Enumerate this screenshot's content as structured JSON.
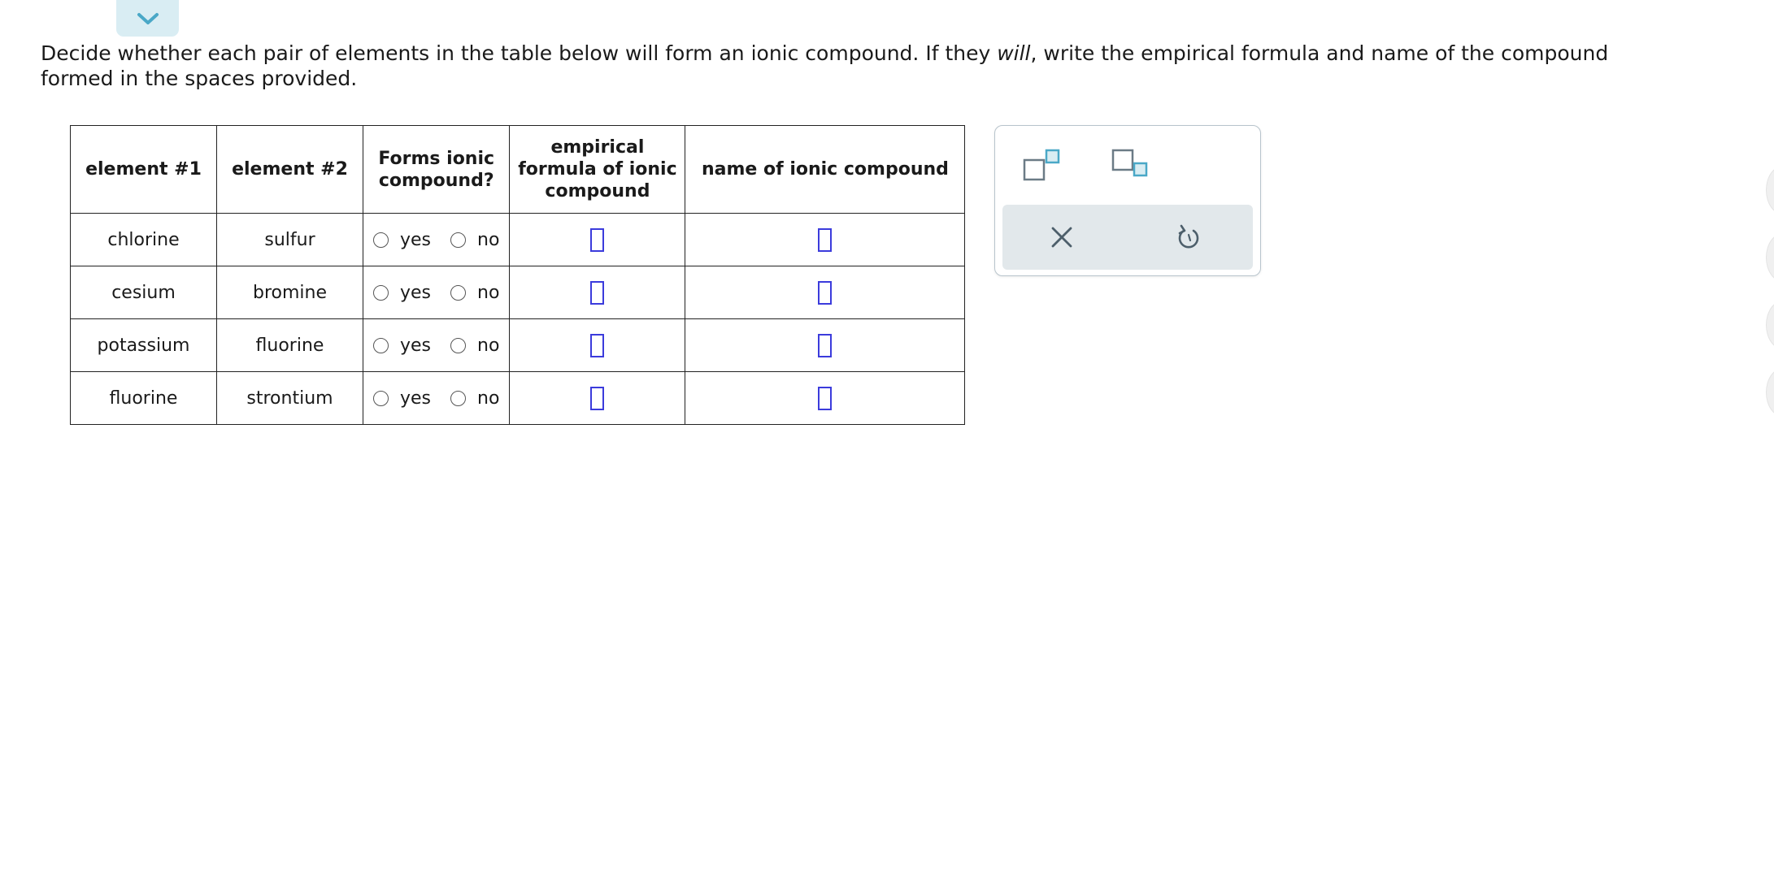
{
  "instructions": {
    "part1": "Decide whether each pair of elements in the table below will form an ionic compound. If they ",
    "emphasis": "will",
    "part2": ", write the empirical formula and name of the compound formed in the spaces provided."
  },
  "table": {
    "headers": {
      "element1": "element #1",
      "element2": "element #2",
      "forms_line1": "Forms ionic",
      "forms_line2": "compound?",
      "formula_line1": "empirical",
      "formula_line2": "formula of ionic",
      "formula_line3": "compound",
      "name": "name of ionic compound"
    },
    "rows": [
      {
        "element1": "chlorine",
        "element2": "sulfur",
        "yes": "yes",
        "no": "no",
        "formula": "",
        "name": ""
      },
      {
        "element1": "cesium",
        "element2": "bromine",
        "yes": "yes",
        "no": "no",
        "formula": "",
        "name": ""
      },
      {
        "element1": "potassium",
        "element2": "fluorine",
        "yes": "yes",
        "no": "no",
        "formula": "",
        "name": ""
      },
      {
        "element1": "fluorine",
        "element2": "strontium",
        "yes": "yes",
        "no": "no",
        "formula": "",
        "name": ""
      }
    ]
  },
  "toolbar": {
    "icons": [
      "superscript-icon",
      "subscript-icon",
      "clear-icon",
      "undo-icon"
    ]
  },
  "colors": {
    "answer_box_border": "#3b3bdc",
    "tool_accent": "#4aa8c7",
    "tool_gray": "#6b7b86",
    "collapse_tab_bg": "#d9edf3"
  }
}
